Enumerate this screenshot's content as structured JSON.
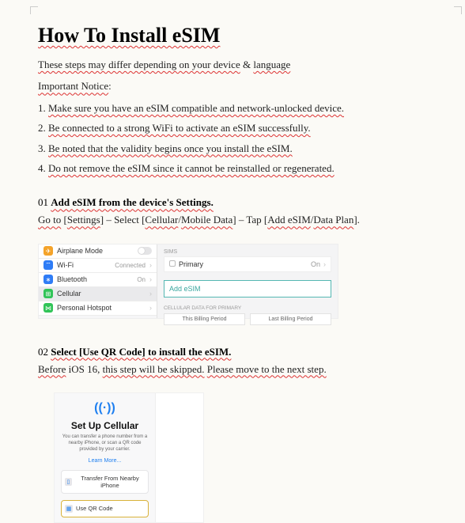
{
  "title": "How To Install eSIM",
  "intro": {
    "t1": "These steps may differ depending on your device",
    "amp": " & ",
    "t2": "language"
  },
  "notice": "Important Notice",
  "rules": [
    {
      "n": "1. ",
      "t": "Make sure you have an eSIM compatible and network-unlocked device."
    },
    {
      "n": "2. ",
      "t": "Be connected to a strong WiFi to activate an eSIM successfully."
    },
    {
      "n": "3. ",
      "t": "Be noted that the validity begins once you install the eSIM."
    },
    {
      "n": "4. ",
      "t": "Do not remove the eSIM since it cannot be reinstalled or regenerated."
    }
  ],
  "step1": {
    "num": "01 ",
    "title": "Add eSIM from the device's Settings.",
    "line": {
      "a": "Go to",
      "b": " [",
      "c": "Settings",
      "d": "] – Select [",
      "e": "Cellular",
      "f": "/",
      "g": "Mobile Data",
      "h": "] – Tap [",
      "i": "Add eSIM",
      "j": "/",
      "k": "Data Plan",
      "l": "]."
    }
  },
  "shot1": {
    "rows": {
      "airplane": "Airplane Mode",
      "wifi": "Wi-Fi",
      "wifi_val": "Connected",
      "bt": "Bluetooth",
      "bt_val": "On",
      "cell": "Cellular",
      "hot": "Personal Hotspot"
    },
    "right": {
      "hdr": "SIMs",
      "primary": "Primary",
      "primary_val": "On",
      "add": "Add eSIM",
      "hdr2": "CELLULAR DATA FOR PRIMARY",
      "tab1": "This Billing Period",
      "tab2": "Last Billing Period"
    }
  },
  "step2": {
    "num": "02 ",
    "title": "Select [Use QR Code] to install the eSIM.",
    "line": {
      "a": "Before",
      "b": " iOS 16, ",
      "c": "this step will be skipped.",
      "d": " ",
      "e": "Please move to the next step."
    }
  },
  "shot2": {
    "heading": "Set Up Cellular",
    "desc": "You can transfer a phone number from a nearby iPhone, or scan a QR code provided by your carrier.",
    "learn": "Learn More...",
    "btn1": "Transfer From Nearby iPhone",
    "btn2": "Use QR Code"
  }
}
